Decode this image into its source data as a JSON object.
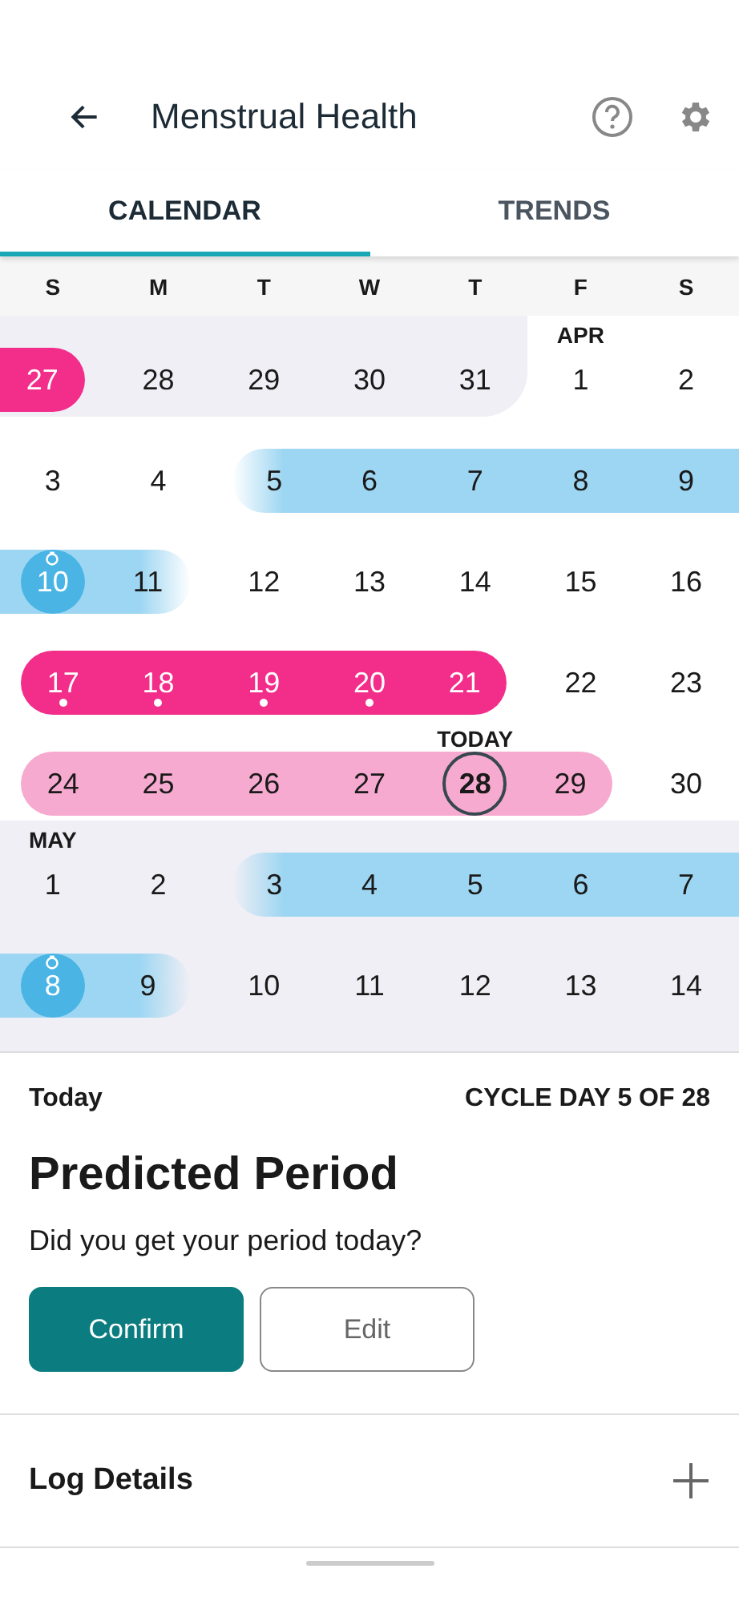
{
  "header": {
    "title": "Menstrual Health"
  },
  "tabs": [
    {
      "label": "CALENDAR",
      "selected": true
    },
    {
      "label": "TRENDS",
      "selected": false
    }
  ],
  "weekdays": [
    "S",
    "M",
    "T",
    "W",
    "T",
    "F",
    "S"
  ],
  "weeks": [
    [
      {
        "n": "27",
        "kind": "period",
        "shaded": true,
        "dot": false,
        "ovulation": false,
        "today": false
      },
      {
        "n": "28",
        "kind": "plain",
        "shaded": true,
        "dot": false,
        "ovulation": false,
        "today": false
      },
      {
        "n": "29",
        "kind": "plain",
        "shaded": true,
        "dot": false,
        "ovulation": false,
        "today": false
      },
      {
        "n": "30",
        "kind": "plain",
        "shaded": true,
        "dot": false,
        "ovulation": false,
        "today": false
      },
      {
        "n": "31",
        "kind": "plain",
        "shaded": true,
        "dot": false,
        "ovulation": false,
        "today": false
      },
      {
        "n": "1",
        "kind": "plain",
        "shaded": false,
        "dot": false,
        "ovulation": false,
        "today": false,
        "label": "APR"
      },
      {
        "n": "2",
        "kind": "plain",
        "shaded": false,
        "dot": false,
        "ovulation": false,
        "today": false
      }
    ],
    [
      {
        "n": "3",
        "kind": "plain",
        "shaded": false,
        "dot": false,
        "ovulation": false,
        "today": false
      },
      {
        "n": "4",
        "kind": "plain",
        "shaded": false,
        "dot": false,
        "ovulation": false,
        "today": false
      },
      {
        "n": "5",
        "kind": "fertile",
        "shaded": false,
        "dot": false,
        "ovulation": false,
        "today": false
      },
      {
        "n": "6",
        "kind": "fertile",
        "shaded": false,
        "dot": false,
        "ovulation": false,
        "today": false
      },
      {
        "n": "7",
        "kind": "fertile",
        "shaded": false,
        "dot": false,
        "ovulation": false,
        "today": false
      },
      {
        "n": "8",
        "kind": "fertile",
        "shaded": false,
        "dot": false,
        "ovulation": false,
        "today": false
      },
      {
        "n": "9",
        "kind": "fertile",
        "shaded": false,
        "dot": false,
        "ovulation": false,
        "today": false
      }
    ],
    [
      {
        "n": "10",
        "kind": "fertile",
        "shaded": false,
        "dot": false,
        "ovulation": true,
        "today": false
      },
      {
        "n": "11",
        "kind": "fertile",
        "shaded": false,
        "dot": false,
        "ovulation": false,
        "today": false
      },
      {
        "n": "12",
        "kind": "plain",
        "shaded": false,
        "dot": false,
        "ovulation": false,
        "today": false
      },
      {
        "n": "13",
        "kind": "plain",
        "shaded": false,
        "dot": false,
        "ovulation": false,
        "today": false
      },
      {
        "n": "14",
        "kind": "plain",
        "shaded": false,
        "dot": false,
        "ovulation": false,
        "today": false
      },
      {
        "n": "15",
        "kind": "plain",
        "shaded": false,
        "dot": false,
        "ovulation": false,
        "today": false
      },
      {
        "n": "16",
        "kind": "plain",
        "shaded": false,
        "dot": false,
        "ovulation": false,
        "today": false
      }
    ],
    [
      {
        "n": "17",
        "kind": "period",
        "shaded": false,
        "dot": true,
        "ovulation": false,
        "today": false
      },
      {
        "n": "18",
        "kind": "period",
        "shaded": false,
        "dot": true,
        "ovulation": false,
        "today": false
      },
      {
        "n": "19",
        "kind": "period",
        "shaded": false,
        "dot": true,
        "ovulation": false,
        "today": false
      },
      {
        "n": "20",
        "kind": "period",
        "shaded": false,
        "dot": true,
        "ovulation": false,
        "today": false
      },
      {
        "n": "21",
        "kind": "period",
        "shaded": false,
        "dot": false,
        "ovulation": false,
        "today": false
      },
      {
        "n": "22",
        "kind": "plain",
        "shaded": false,
        "dot": false,
        "ovulation": false,
        "today": false
      },
      {
        "n": "23",
        "kind": "plain",
        "shaded": false,
        "dot": false,
        "ovulation": false,
        "today": false
      }
    ],
    [
      {
        "n": "24",
        "kind": "predicted",
        "shaded": false,
        "dot": false,
        "ovulation": false,
        "today": false
      },
      {
        "n": "25",
        "kind": "predicted",
        "shaded": false,
        "dot": false,
        "ovulation": false,
        "today": false
      },
      {
        "n": "26",
        "kind": "predicted",
        "shaded": false,
        "dot": false,
        "ovulation": false,
        "today": false
      },
      {
        "n": "27",
        "kind": "predicted",
        "shaded": false,
        "dot": false,
        "ovulation": false,
        "today": false
      },
      {
        "n": "28",
        "kind": "predicted",
        "shaded": false,
        "dot": false,
        "ovulation": false,
        "today": true,
        "label": "TODAY"
      },
      {
        "n": "29",
        "kind": "predicted",
        "shaded": false,
        "dot": false,
        "ovulation": false,
        "today": false
      },
      {
        "n": "30",
        "kind": "plain",
        "shaded": false,
        "dot": false,
        "ovulation": false,
        "today": false
      }
    ],
    [
      {
        "n": "1",
        "kind": "plain",
        "shaded": true,
        "dot": false,
        "ovulation": false,
        "today": false,
        "label": "MAY"
      },
      {
        "n": "2",
        "kind": "plain",
        "shaded": true,
        "dot": false,
        "ovulation": false,
        "today": false
      },
      {
        "n": "3",
        "kind": "fertile",
        "shaded": true,
        "dot": false,
        "ovulation": false,
        "today": false
      },
      {
        "n": "4",
        "kind": "fertile",
        "shaded": true,
        "dot": false,
        "ovulation": false,
        "today": false
      },
      {
        "n": "5",
        "kind": "fertile",
        "shaded": true,
        "dot": false,
        "ovulation": false,
        "today": false
      },
      {
        "n": "6",
        "kind": "fertile",
        "shaded": true,
        "dot": false,
        "ovulation": false,
        "today": false
      },
      {
        "n": "7",
        "kind": "fertile",
        "shaded": true,
        "dot": false,
        "ovulation": false,
        "today": false
      }
    ],
    [
      {
        "n": "8",
        "kind": "fertile",
        "shaded": true,
        "dot": false,
        "ovulation": true,
        "today": false
      },
      {
        "n": "9",
        "kind": "fertile",
        "shaded": true,
        "dot": false,
        "ovulation": false,
        "today": false
      },
      {
        "n": "10",
        "kind": "plain",
        "shaded": true,
        "dot": false,
        "ovulation": false,
        "today": false
      },
      {
        "n": "11",
        "kind": "plain",
        "shaded": true,
        "dot": false,
        "ovulation": false,
        "today": false
      },
      {
        "n": "12",
        "kind": "plain",
        "shaded": true,
        "dot": false,
        "ovulation": false,
        "today": false
      },
      {
        "n": "13",
        "kind": "plain",
        "shaded": true,
        "dot": false,
        "ovulation": false,
        "today": false
      },
      {
        "n": "14",
        "kind": "plain",
        "shaded": true,
        "dot": false,
        "ovulation": false,
        "today": false
      }
    ]
  ],
  "summary": {
    "day_label": "Today",
    "cycle": "CYCLE DAY 5 OF 28",
    "title": "Predicted Period",
    "question": "Did you get your period today?",
    "buttons": [
      {
        "label": "Confirm",
        "kind": "primary"
      },
      {
        "label": "Edit",
        "kind": "secondary"
      }
    ]
  },
  "log": {
    "label": "Log Details"
  }
}
